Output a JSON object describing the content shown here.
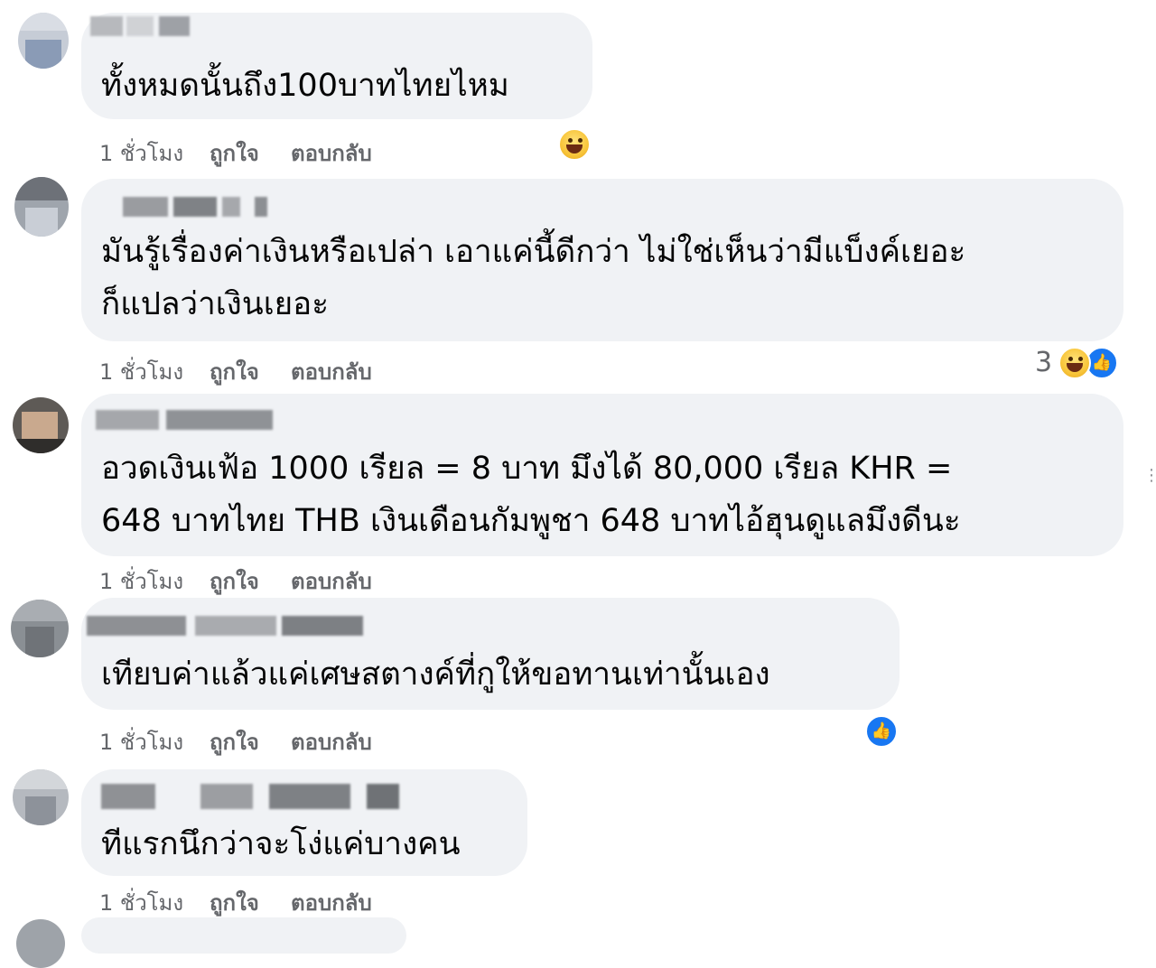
{
  "comments": [
    {
      "text": "ทั้งหมดนั้นถึง100บาทไทยไหม",
      "time": "1 ชั่วโมง",
      "like_label": "ถูกใจ",
      "reply_label": "ตอบกลับ",
      "reactions": {
        "count": "",
        "icons": [
          "haha-emoji-icon"
        ]
      }
    },
    {
      "text": "มันรู้เรื่องค่าเงินหรือเปล่า เอาแค่นี้ดีกว่า ไม่ใช่เห็นว่ามีแบ็งค์เยอะ\nก็แปลว่าเงินเยอะ",
      "time": "1 ชั่วโมง",
      "like_label": "ถูกใจ",
      "reply_label": "ตอบกลับ",
      "reactions": {
        "count": "3",
        "icons": [
          "haha-emoji-icon",
          "like-icon"
        ]
      }
    },
    {
      "text": "อวดเงินเฟ้อ 1000 เรียล = 8 บาท มึงได้ 80,000 เรียล KHR =\n648 บาทไทย THB เงินเดือนกัมพูชา 648 บาทไอ้ฮุนดูแลมึงดีนะ",
      "time": "1 ชั่วโมง",
      "like_label": "ถูกใจ",
      "reply_label": "ตอบกลับ",
      "reactions": {
        "count": "",
        "icons": []
      }
    },
    {
      "text": "เทียบค่าแล้วแค่เศษสตางค์ที่กูให้ขอทานเท่านั้นเอง",
      "time": "1 ชั่วโมง",
      "like_label": "ถูกใจ",
      "reply_label": "ตอบกลับ",
      "reactions": {
        "count": "",
        "icons": [
          "like-icon"
        ]
      }
    },
    {
      "text": "ทีแรกนึกว่าจะโง่แค่บางคน",
      "time": "1 ชั่วโมง",
      "like_label": "ถูกใจ",
      "reply_label": "ตอบกลับ",
      "reactions": {
        "count": "",
        "icons": []
      }
    }
  ],
  "colors": {
    "bubble": "#f0f2f5",
    "meta_text": "#65676b",
    "like_blue": "#1877f2",
    "haha_yellow": "#f8c53a"
  },
  "more_options_glyph": "⋮",
  "like_glyph": "👍"
}
